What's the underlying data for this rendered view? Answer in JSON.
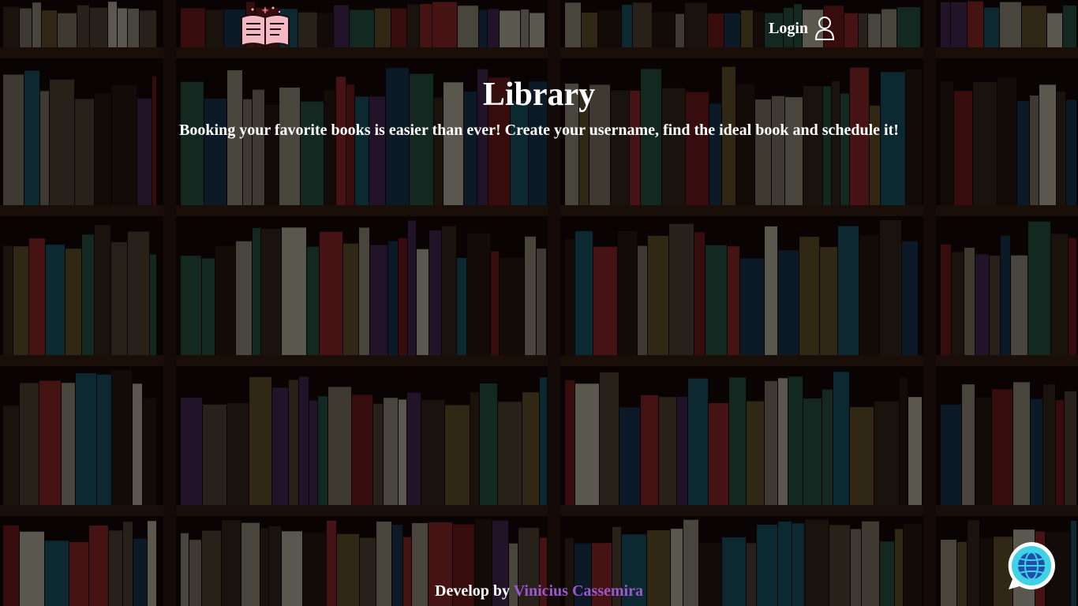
{
  "header": {
    "logo_icon": "open-book-icon",
    "login_label": "Login",
    "login_icon": "user-icon"
  },
  "hero": {
    "title": "Library",
    "subtitle": "Booking your favorite books is easier than ever! Create your username, find the ideal book and schedule it!"
  },
  "footer": {
    "prefix": "Develop by",
    "author": "Vinicius Cassemira",
    "author_color": "#9b59d0"
  },
  "widgets": {
    "chat_icon": "globe-chat-icon"
  },
  "colors": {
    "text": "#ffffff",
    "logo_pink": "#f4b8c4",
    "chat_cyan": "#3fd1e8"
  }
}
